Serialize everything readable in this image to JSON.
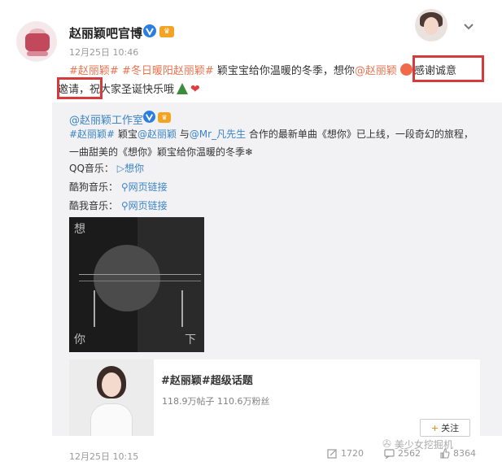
{
  "post": {
    "author": "赵丽颖吧官博",
    "time": "12月25日 10:46",
    "text": {
      "tag1": "#赵丽颖#",
      "tag2": "#冬日暖阳赵丽颖#",
      "body1": " 颖宝宝给你温暖的冬季，想你",
      "mention": "@赵丽颖",
      "highlight1": "感谢诚意",
      "highlight2": "邀请",
      "body2": "，祝大家圣诞快乐哦"
    }
  },
  "repost": {
    "author": "@赵丽颖工作室",
    "line1": {
      "tag": "#赵丽颖#",
      "a": " 颖宝",
      "mention1": "@赵丽颖",
      "b": " 与",
      "mention2": "@Mr_凡先生",
      "c": " 合作的最新单曲《想你》已上线，一段奇幻的旅程，"
    },
    "line2": "一曲甜美的《想你》颖宝给你温暖的冬季❄",
    "music": [
      {
        "label": "QQ音乐：",
        "value": "▷想你"
      },
      {
        "label": "酷狗音乐：",
        "value": "网页链接"
      },
      {
        "label": "酷我音乐：",
        "value": "网页链接"
      }
    ],
    "album": {
      "char_top_left": "想",
      "char_top_right": "",
      "char_bottom_left": "你",
      "char_bottom_right": "下"
    },
    "topic": {
      "title": "#赵丽颖#超级话题",
      "stats": "118.9万帖子  110.6万粉丝",
      "follow_label": "关注"
    },
    "time": "12月25日 10:15",
    "actions": {
      "repost": "1720",
      "comment": "2562",
      "like": "8364"
    }
  },
  "watermark": "美少女挖掘机"
}
